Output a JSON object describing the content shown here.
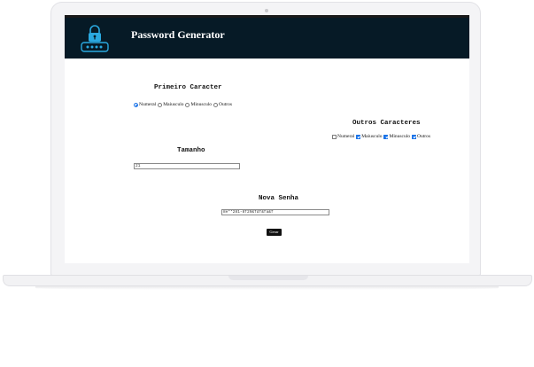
{
  "app": {
    "title": "Password Generator",
    "logo_icon": "password-lock-icon",
    "header_color": "#061a26"
  },
  "first_char": {
    "heading": "Primeiro Caracter",
    "options": [
      {
        "label": "Numeral",
        "checked": true
      },
      {
        "label": "Maiusculo",
        "checked": false
      },
      {
        "label": "Minusculo",
        "checked": false
      },
      {
        "label": "Outros",
        "checked": false
      }
    ]
  },
  "other_chars": {
    "heading": "Outros Caracteres",
    "options": [
      {
        "label": "Numeral",
        "checked": false
      },
      {
        "label": "Maiusculo",
        "checked": true
      },
      {
        "label": "Minusculo",
        "checked": true
      },
      {
        "label": "Outros",
        "checked": true
      }
    ]
  },
  "size": {
    "heading": "Tamanho",
    "value": "21"
  },
  "new_password": {
    "heading": "Nova Senha",
    "value": "8e**281-8f29&fdf&fa&f"
  },
  "generate_label": "Gerar",
  "accent_color": "#1a73e8"
}
